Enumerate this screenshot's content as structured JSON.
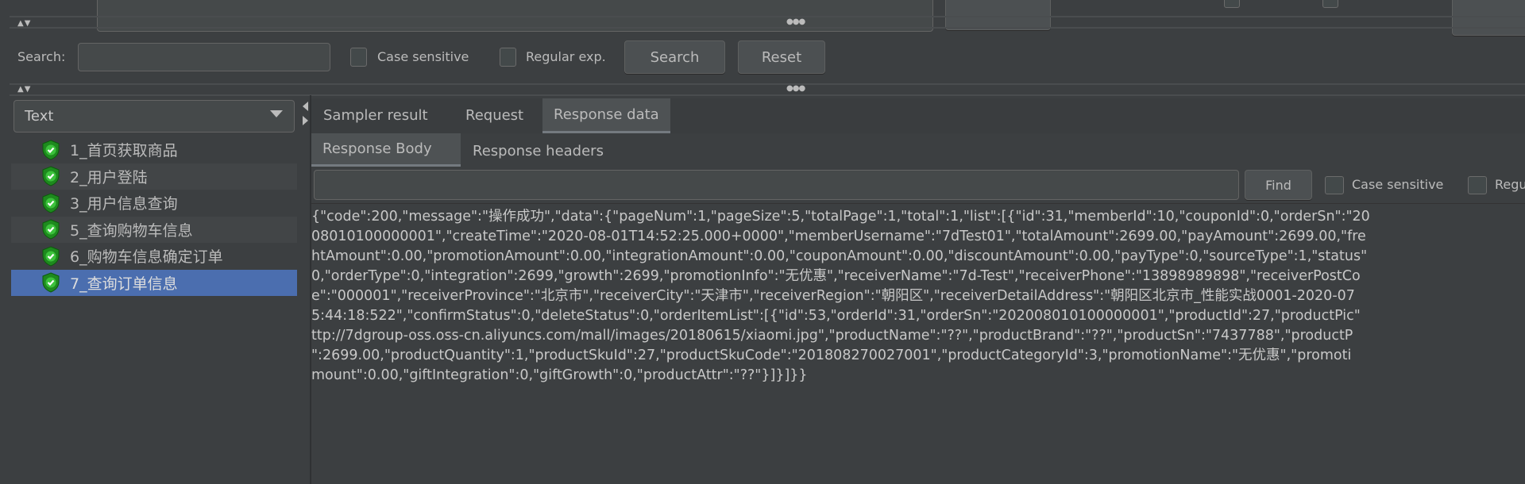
{
  "search_bar": {
    "label": "Search:",
    "value": "",
    "case_sensitive_label": "Case sensitive",
    "regex_label": "Regular exp.",
    "search_button": "Search",
    "reset_button": "Reset"
  },
  "left_panel": {
    "renderer_select": "Text",
    "samples": [
      {
        "label": "1_首页获取商品",
        "status": "success"
      },
      {
        "label": "2_用户登陆",
        "status": "success"
      },
      {
        "label": "3_用户信息查询",
        "status": "success"
      },
      {
        "label": "5_查询购物车信息",
        "status": "success"
      },
      {
        "label": "6_购物车信息确定订单",
        "status": "success"
      },
      {
        "label": "7_查询订单信息",
        "status": "success",
        "selected": true
      }
    ]
  },
  "tabs": [
    {
      "label": "Sampler result"
    },
    {
      "label": "Request"
    },
    {
      "label": "Response data",
      "active": true
    }
  ],
  "subtabs": [
    {
      "label": "Response Body",
      "active": true
    },
    {
      "label": "Response headers"
    }
  ],
  "find_bar": {
    "value": "",
    "find_button": "Find",
    "case_sensitive_label": "Case sensitive",
    "regex_label": "Regu"
  },
  "response_lines": [
    "{\"code\":200,\"message\":\"操作成功\",\"data\":{\"pageNum\":1,\"pageSize\":5,\"totalPage\":1,\"total\":1,\"list\":[{\"id\":31,\"memberId\":10,\"couponId\":0,\"orderSn\":\"20",
    "08010100000001\",\"createTime\":\"2020-08-01T14:52:25.000+0000\",\"memberUsername\":\"7dTest01\",\"totalAmount\":2699.00,\"payAmount\":2699.00,\"fre",
    "htAmount\":0.00,\"promotionAmount\":0.00,\"integrationAmount\":0.00,\"couponAmount\":0.00,\"discountAmount\":0.00,\"payType\":0,\"sourceType\":1,\"status\"",
    "0,\"orderType\":0,\"integration\":2699,\"growth\":2699,\"promotionInfo\":\"无优惠\",\"receiverName\":\"7d-Test\",\"receiverPhone\":\"13898989898\",\"receiverPostCo",
    "e\":\"000001\",\"receiverProvince\":\"北京市\",\"receiverCity\":\"天津市\",\"receiverRegion\":\"朝阳区\",\"receiverDetailAddress\":\"朝阳区北京市_性能实战0001-2020-07",
    "5:44:18:522\",\"confirmStatus\":0,\"deleteStatus\":0,\"orderItemList\":[{\"id\":53,\"orderId\":31,\"orderSn\":\"202008010100000001\",\"productId\":27,\"productPic\"",
    "ttp://7dgroup-oss.oss-cn.aliyuncs.com/mall/images/20180615/xiaomi.jpg\",\"productName\":\"??\",\"productBrand\":\"??\",\"productSn\":\"7437788\",\"productP",
    "\":2699.00,\"productQuantity\":1,\"productSkuId\":27,\"productSkuCode\":\"201808270027001\",\"productCategoryId\":3,\"promotionName\":\"无优惠\",\"promoti",
    "mount\":0.00,\"giftIntegration\":0,\"giftGrowth\":0,\"productAttr\":\"??\"}]}]}}"
  ],
  "colors": {
    "background": "#3c3f41",
    "selection": "#4b6eaf",
    "success_icon": "#2fa52f"
  }
}
